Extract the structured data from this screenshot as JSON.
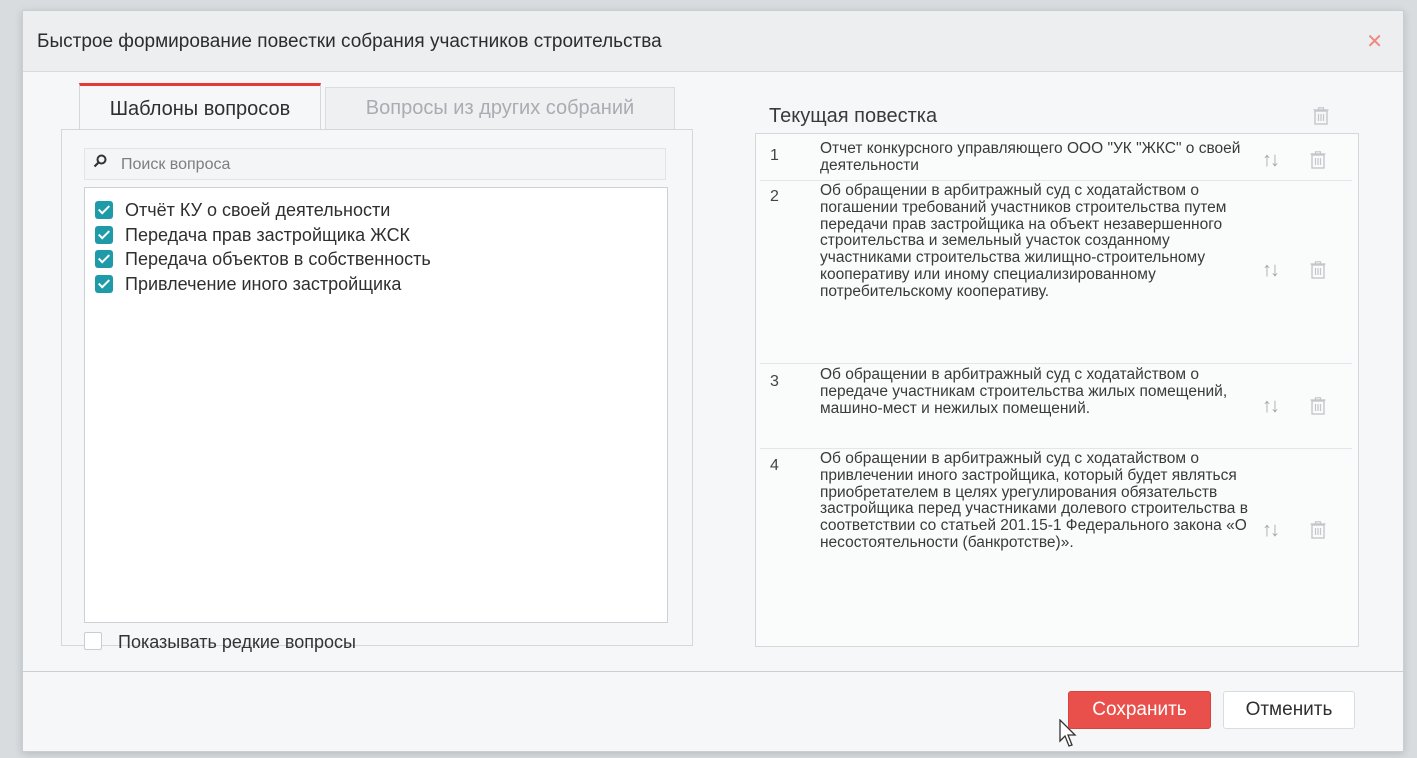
{
  "dialog": {
    "title": "Быстрое формирование повестки собрания участников строительства",
    "close_icon": "close-icon",
    "accent_color": "#e53935"
  },
  "tabs": [
    {
      "label": "Шаблоны вопросов",
      "active": true
    },
    {
      "label": "Вопросы из других собраний",
      "active": false
    }
  ],
  "search": {
    "placeholder": "Поиск вопроса",
    "value": ""
  },
  "questions": [
    {
      "label": "Отчёт КУ о своей деятельности",
      "checked": true
    },
    {
      "label": "Передача прав застройщика ЖСК",
      "checked": true
    },
    {
      "label": "Передача объектов в собственность",
      "checked": true
    },
    {
      "label": "Привлечение иного застройщика",
      "checked": true
    }
  ],
  "show_rare": {
    "label": "Показывать редкие вопросы",
    "checked": false
  },
  "agenda": {
    "title": "Текущая повестка",
    "items": [
      {
        "num": "1",
        "text": "Отчет конкурсного управляющего ООО \"УК \"ЖКС\" о своей деятельности",
        "move_icon": "↑↓"
      },
      {
        "num": "2",
        "text": "Об обращении в арбитражный суд с ходатайством о погашении требований участников строительства путем передачи прав застройщика на объект незавершенного строительства и земельный участок созданному участниками строительства жилищно-строительному кооперативу или иному специализированному потребительскому кооперативу.",
        "move_icon": "↑↓"
      },
      {
        "num": "3",
        "text": "Об обращении в арбитражный суд с ходатайством о передаче участникам строительства жилых помещений, машино-мест и нежилых помещений.",
        "move_icon": "↑↓"
      },
      {
        "num": "4",
        "text": "Об обращении в арбитражный суд с ходатайством о привлечении иного застройщика, который будет являться приобретателем в целях урегулирования обязательств застройщика перед участниками долевого строительства в соответствии со статьей 201.15-1 Федерального закона «О несостоятельности (банкротстве)».",
        "move_icon": "↑↓"
      }
    ]
  },
  "buttons": {
    "save": "Сохранить",
    "cancel": "Отменить"
  },
  "colors": {
    "save": "#e9504b",
    "checkbox": "#1e9aa8"
  }
}
